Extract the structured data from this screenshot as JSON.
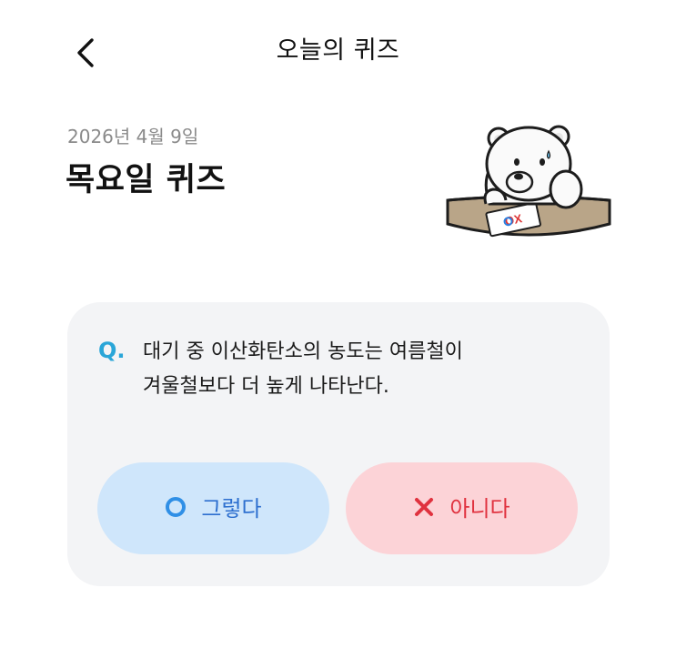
{
  "header": {
    "title": "오늘의 퀴즈",
    "back_icon": "chevron-left-icon"
  },
  "quiz": {
    "date": "2026년 4월 9일",
    "heading": "목요일 퀴즈",
    "question_marker": "Q.",
    "question_line1": "대기 중 이산화탄소의 농도는 여름철이",
    "question_line2": "겨울철보다 더 높게 나타난다.",
    "mascot_paper_text": "OX"
  },
  "answers": {
    "yes_label": "그렇다",
    "yes_icon": "circle-o-icon",
    "no_label": "아니다",
    "no_icon": "x-mark-icon"
  },
  "colors": {
    "accent_blue": "#2aa6d8",
    "yes_bg": "#cfe6fb",
    "yes_fg": "#2d6fcf",
    "no_bg": "#fcd3d7",
    "no_fg": "#e0323f",
    "card_bg": "#f3f4f6"
  }
}
